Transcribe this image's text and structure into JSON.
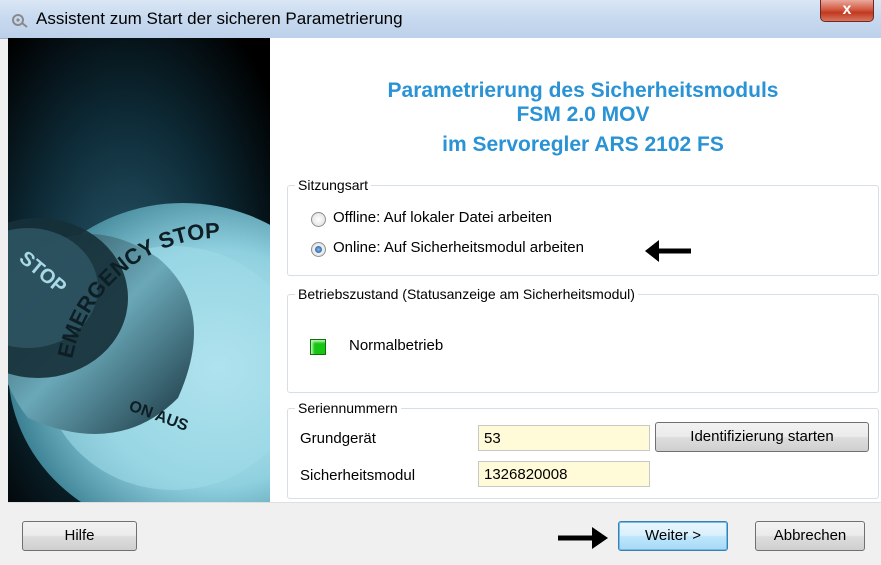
{
  "window": {
    "title": "Assistent zum Start der sicheren Parametrierung",
    "close_label": "x"
  },
  "heading": {
    "line1": "Parametrierung des Sicherheitsmoduls",
    "line2": "FSM 2.0 MOV",
    "line3": "im Servoregler ARS 2102 FS"
  },
  "session": {
    "legend": "Sitzungsart",
    "options": [
      {
        "label": "Offline: Auf lokaler Datei arbeiten",
        "checked": false
      },
      {
        "label": "Online: Auf Sicherheitsmodul arbeiten",
        "checked": true
      }
    ]
  },
  "status": {
    "legend": "Betriebszustand (Statusanzeige am Sicherheitsmodul)",
    "led_color": "#17c514",
    "label": "Normalbetrieb"
  },
  "serials": {
    "legend": "Seriennummern",
    "base_label": "Grundgerät",
    "base_value": "53",
    "module_label": "Sicherheitsmodul",
    "module_value": "1326820008",
    "identify_button": "Identifizierung starten"
  },
  "image": {
    "ring_text": "EMERGENCY STOP",
    "ring_text_lower": "ON AUS",
    "button_text": "STOP"
  },
  "footer": {
    "help": "Hilfe",
    "next": "Weiter >",
    "cancel": "Abbrechen"
  },
  "colors": {
    "heading": "#2a93d5",
    "field_bg": "#fffbd9"
  }
}
